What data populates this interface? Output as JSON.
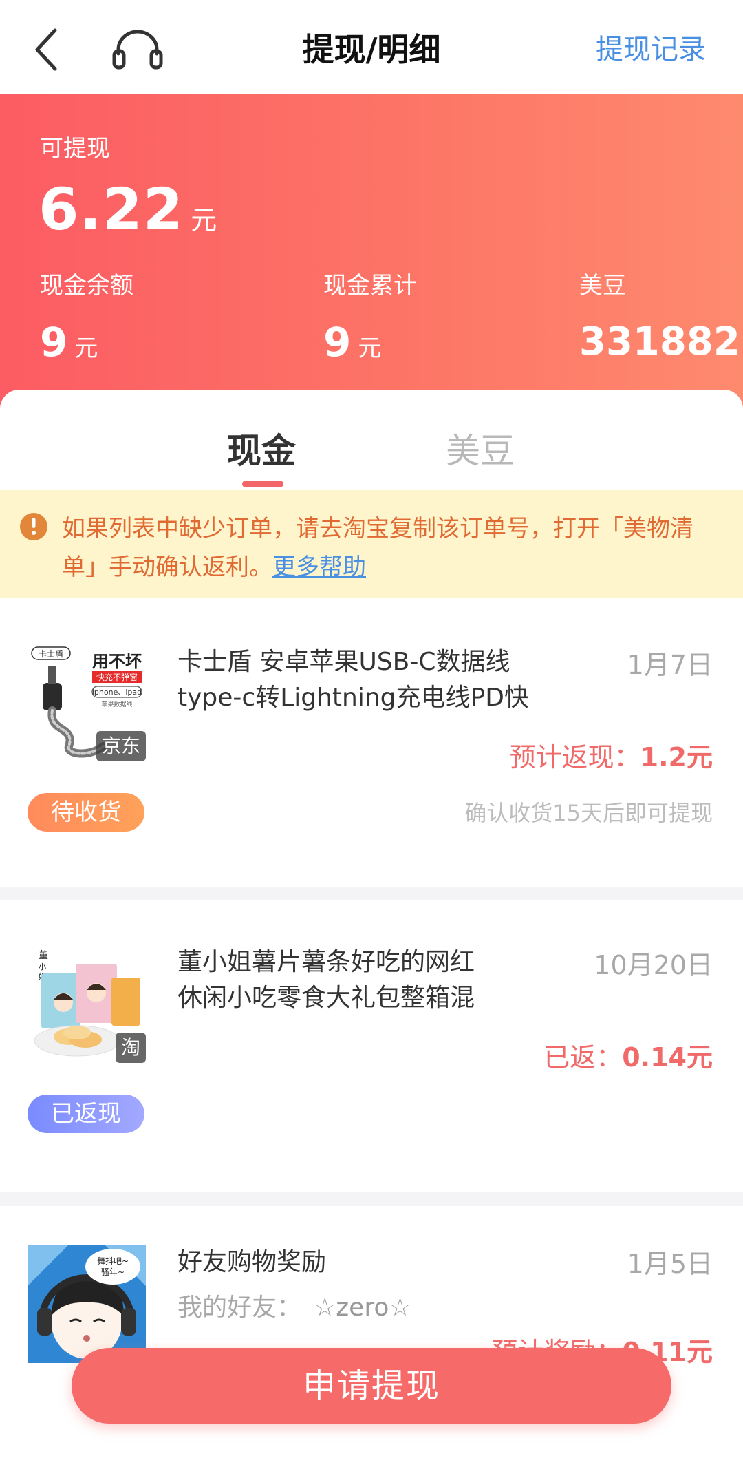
{
  "nav": {
    "title": "提现/明细",
    "right_link": "提现记录",
    "back_icon": "chevron-left-icon",
    "service_icon": "headset-icon"
  },
  "summary": {
    "withdrawable_label": "可提现",
    "withdrawable_amount": "6.22",
    "withdrawable_unit": "元",
    "stats": [
      {
        "label": "现金余额",
        "value": "9",
        "unit": "元"
      },
      {
        "label": "现金累计",
        "value": "9",
        "unit": "元"
      },
      {
        "label": "美豆",
        "value": "331882"
      }
    ]
  },
  "tabs": [
    {
      "label": "现金",
      "active": true
    },
    {
      "label": "美豆",
      "active": false
    }
  ],
  "notice": {
    "text": "如果列表中缺少订单，请去淘宝复制该订单号，打开「美物清单」手动确认返利。",
    "link": "更多帮助",
    "icon": "info-icon"
  },
  "orders": [
    {
      "title": "卡士盾 安卓苹果USB-C数据线type-c转Lightning充电线PD快",
      "date": "1月7日",
      "amount_label": "预计返现：",
      "amount_value": "1.2元",
      "status": "待收货",
      "note": "确认收货15天后即可提现",
      "platform": "京东",
      "thumb_brand": "卡士盾",
      "thumb_slogan": "用不坏",
      "thumb_tag": "快充不弹窗",
      "thumb_models": "iphone、ipad",
      "thumb_sub": "苹果数据线"
    },
    {
      "title": "董小姐薯片薯条好吃的网红休闲小吃零食大礼包整箱混",
      "date": "10月20日",
      "amount_label": "已返：",
      "amount_value": "0.14元",
      "status": "已返现",
      "platform": "淘",
      "thumb_brand": "董小姐"
    },
    {
      "title": "好友购物奖励",
      "date": "1月5日",
      "friend_label": "我的好友：",
      "friend_name": "☆zero☆",
      "amount_label": "预计奖励：",
      "amount_value": "0.11元",
      "thumb_bubble": "舞抖吧~骚年~"
    }
  ],
  "apply_button": "申请提现",
  "colors": {
    "header_gradient_start": "#fc5c63",
    "header_gradient_end": "#fe8a6e",
    "accent_red": "#f66a6a",
    "link_blue": "#4a90e2",
    "notice_bg": "#fff5cc",
    "notice_text": "#e06a34"
  }
}
